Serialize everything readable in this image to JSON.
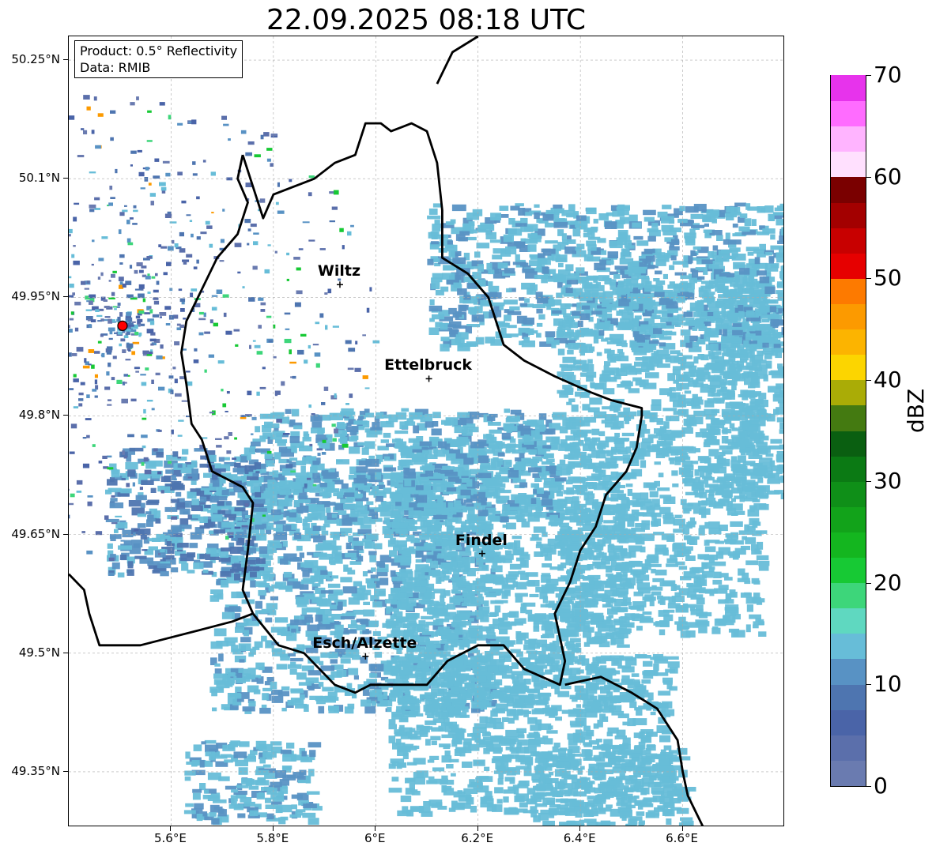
{
  "title": "22.09.2025 08:18 UTC",
  "info": {
    "product": "Product: 0.5° Reflectivity",
    "data": "Data: RMIB"
  },
  "map": {
    "lon_range": [
      5.4,
      6.8
    ],
    "lat_range": [
      49.28,
      50.28
    ],
    "radar_site": {
      "lon": 5.505,
      "lat": 49.914
    },
    "lat_ticks": [
      {
        "value": 50.25,
        "label": "50.25°N"
      },
      {
        "value": 50.1,
        "label": "50.1°N"
      },
      {
        "value": 49.95,
        "label": "49.95°N"
      },
      {
        "value": 49.8,
        "label": "49.8°N"
      },
      {
        "value": 49.65,
        "label": "49.65°N"
      },
      {
        "value": 49.5,
        "label": "49.5°N"
      },
      {
        "value": 49.35,
        "label": "49.35°N"
      }
    ],
    "lon_ticks": [
      {
        "value": 5.6,
        "label": "5.6°E"
      },
      {
        "value": 5.8,
        "label": "5.8°E"
      },
      {
        "value": 6.0,
        "label": "6°E"
      },
      {
        "value": 6.2,
        "label": "6.2°E"
      },
      {
        "value": 6.4,
        "label": "6.4°E"
      },
      {
        "value": 6.6,
        "label": "6.6°E"
      }
    ],
    "cities": [
      {
        "name": "Wiltz",
        "lon": 5.93,
        "lat": 49.966
      },
      {
        "name": "Ettelbruck",
        "lon": 6.104,
        "lat": 49.847
      },
      {
        "name": "Findel",
        "lon": 6.208,
        "lat": 49.626
      },
      {
        "name": "Esch/Alzette",
        "lon": 5.98,
        "lat": 49.496
      }
    ],
    "luxembourg_border": [
      [
        5.74,
        50.13
      ],
      [
        5.73,
        50.1
      ],
      [
        5.75,
        50.07
      ],
      [
        5.73,
        50.03
      ],
      [
        5.69,
        50.0
      ],
      [
        5.66,
        49.96
      ],
      [
        5.63,
        49.92
      ],
      [
        5.62,
        49.88
      ],
      [
        5.63,
        49.84
      ],
      [
        5.64,
        49.79
      ],
      [
        5.66,
        49.77
      ],
      [
        5.68,
        49.73
      ],
      [
        5.74,
        49.71
      ],
      [
        5.76,
        49.69
      ],
      [
        5.75,
        49.63
      ],
      [
        5.74,
        49.58
      ],
      [
        5.76,
        49.55
      ],
      [
        5.81,
        49.51
      ],
      [
        5.86,
        49.5
      ],
      [
        5.89,
        49.48
      ],
      [
        5.92,
        49.46
      ],
      [
        5.96,
        49.45
      ],
      [
        5.99,
        49.46
      ],
      [
        6.05,
        49.46
      ],
      [
        6.1,
        49.46
      ],
      [
        6.14,
        49.49
      ],
      [
        6.2,
        49.51
      ],
      [
        6.25,
        49.51
      ],
      [
        6.29,
        49.48
      ],
      [
        6.36,
        49.46
      ],
      [
        6.37,
        49.49
      ],
      [
        6.35,
        49.55
      ],
      [
        6.38,
        49.59
      ],
      [
        6.4,
        49.63
      ],
      [
        6.43,
        49.66
      ],
      [
        6.45,
        49.7
      ],
      [
        6.49,
        49.73
      ],
      [
        6.51,
        49.76
      ],
      [
        6.52,
        49.8
      ],
      [
        6.52,
        49.81
      ],
      [
        6.46,
        49.82
      ],
      [
        6.42,
        49.83
      ],
      [
        6.35,
        49.85
      ],
      [
        6.29,
        49.87
      ],
      [
        6.25,
        49.89
      ],
      [
        6.22,
        49.95
      ],
      [
        6.18,
        49.98
      ],
      [
        6.13,
        50.0
      ],
      [
        6.13,
        50.06
      ],
      [
        6.12,
        50.12
      ],
      [
        6.1,
        50.16
      ],
      [
        6.07,
        50.17
      ],
      [
        6.03,
        50.16
      ],
      [
        6.01,
        50.17
      ],
      [
        5.98,
        50.17
      ],
      [
        5.96,
        50.13
      ],
      [
        5.92,
        50.12
      ],
      [
        5.88,
        50.1
      ],
      [
        5.84,
        50.09
      ],
      [
        5.8,
        50.08
      ],
      [
        5.78,
        50.05
      ],
      [
        5.74,
        50.13
      ]
    ],
    "belgium_germany_border": [
      [
        6.12,
        50.22
      ],
      [
        6.15,
        50.26
      ],
      [
        6.2,
        50.28
      ]
    ],
    "france_border": [
      [
        5.4,
        49.6
      ],
      [
        5.43,
        49.58
      ],
      [
        5.44,
        49.55
      ],
      [
        5.46,
        49.51
      ],
      [
        5.5,
        49.51
      ],
      [
        5.54,
        49.51
      ],
      [
        5.6,
        49.52
      ],
      [
        5.66,
        49.53
      ],
      [
        5.72,
        49.54
      ],
      [
        5.76,
        49.55
      ]
    ],
    "germany_saar_border": [
      [
        6.37,
        49.46
      ],
      [
        6.44,
        49.47
      ],
      [
        6.5,
        49.45
      ],
      [
        6.55,
        49.43
      ],
      [
        6.59,
        49.39
      ],
      [
        6.6,
        49.35
      ],
      [
        6.61,
        49.32
      ],
      [
        6.64,
        49.28
      ]
    ],
    "radar_swaths": [
      {
        "lon": 5.95,
        "lat": 49.58,
        "w": 0.55,
        "h": 0.3,
        "level": 5
      },
      {
        "lon": 6.25,
        "lat": 49.6,
        "w": 0.45,
        "h": 0.35,
        "level": 6
      },
      {
        "lon": 6.05,
        "lat": 49.74,
        "w": 0.6,
        "h": 0.14,
        "level": 5
      },
      {
        "lon": 6.3,
        "lat": 49.4,
        "w": 0.55,
        "h": 0.2,
        "level": 6
      },
      {
        "lon": 6.55,
        "lat": 49.75,
        "w": 0.4,
        "h": 0.45,
        "level": 6
      },
      {
        "lon": 6.72,
        "lat": 49.85,
        "w": 0.16,
        "h": 0.3,
        "level": 8
      },
      {
        "lon": 6.45,
        "lat": 49.98,
        "w": 0.7,
        "h": 0.18,
        "level": 5
      },
      {
        "lon": 5.75,
        "lat": 49.34,
        "w": 0.25,
        "h": 0.1,
        "level": 5
      },
      {
        "lon": 5.62,
        "lat": 49.68,
        "w": 0.3,
        "h": 0.16,
        "level": 4
      },
      {
        "lon": 6.45,
        "lat": 49.33,
        "w": 0.3,
        "h": 0.1,
        "level": 6
      }
    ],
    "colorbar": {
      "label": "dBZ",
      "min": 0,
      "max": 70,
      "ticks": [
        0,
        10,
        20,
        30,
        40,
        50,
        60,
        70
      ],
      "colors": [
        "#6a7bb0",
        "#5b6fab",
        "#4a64a8",
        "#4e75b0",
        "#5892c4",
        "#67bdd8",
        "#5fd8c0",
        "#3dd67a",
        "#17c934",
        "#14b61f",
        "#12a31a",
        "#0f8f18",
        "#0b7a14",
        "#0a5f11",
        "#447a11",
        "#aaac06",
        "#fcd500",
        "#fcb400",
        "#fc9a00",
        "#fd7a00",
        "#e60000",
        "#c80000",
        "#a30000",
        "#7a0000",
        "#ffe0fe",
        "#ffb4ff",
        "#ff6cff",
        "#e733ec"
      ]
    }
  }
}
